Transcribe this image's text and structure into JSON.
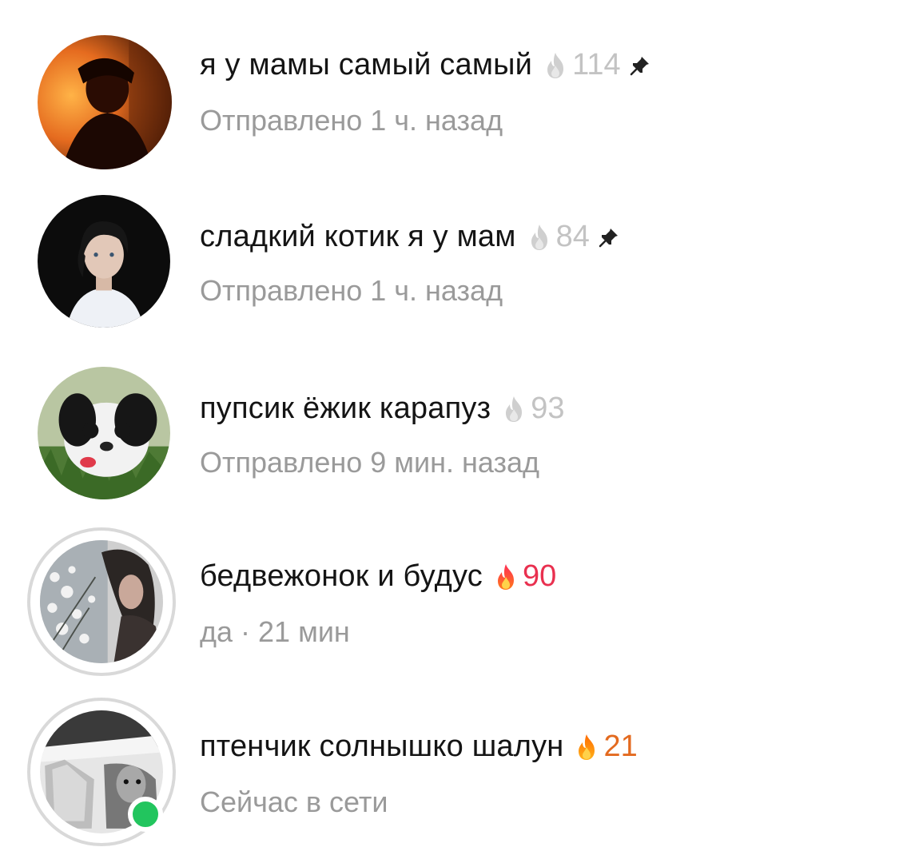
{
  "chats": [
    {
      "name": "я у мамы самый самый",
      "streak_count": "114",
      "status": "Отправлено 1 ч. назад",
      "streak_active": false,
      "pinned": true,
      "avatar_icon": "avatar-dark-orange-portrait",
      "story_ring": false,
      "online": false
    },
    {
      "name": "сладкий котик я у мам",
      "streak_count": "84",
      "status": "Отправлено 1 ч. назад",
      "streak_active": false,
      "pinned": true,
      "avatar_icon": "avatar-boy-white-shirt",
      "story_ring": false,
      "online": false
    },
    {
      "name": "пупсик ёжик карапуз",
      "streak_count": "93",
      "status": "Отправлено 9 мин. назад",
      "streak_active": false,
      "pinned": false,
      "avatar_icon": "avatar-small-dog",
      "story_ring": false,
      "online": false
    },
    {
      "name": "бедвежонок и будус",
      "streak_count": "90",
      "status": "да · 21 мин",
      "streak_active": true,
      "pinned": false,
      "avatar_icon": "avatar-girl-flowers",
      "story_ring": true,
      "online": false
    },
    {
      "name": "птенчик солнышко шалун",
      "streak_count": "21",
      "status": "Сейчас в сети",
      "streak_active": true,
      "pinned": false,
      "avatar_icon": "avatar-bw-cat",
      "story_ring": true,
      "online": true
    }
  ],
  "colors": {
    "streak_inactive": "#c3c3c3",
    "streak_active_pink": "#e9304f",
    "streak_active_orange": "#e36a1f",
    "online": "#22c55e",
    "story_ring": "#d9d9d9"
  }
}
